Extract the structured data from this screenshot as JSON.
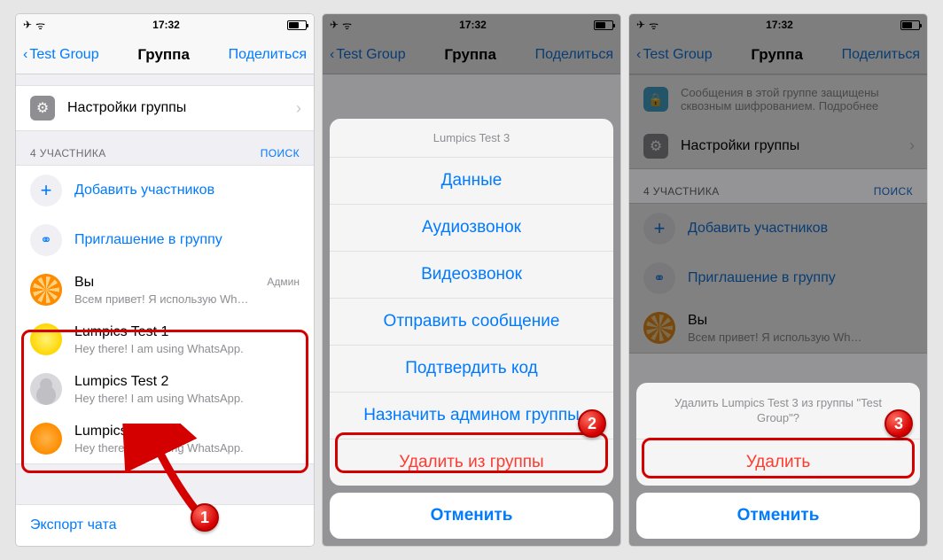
{
  "status": {
    "time": "17:32"
  },
  "nav": {
    "back": "Test Group",
    "title": "Группа",
    "action": "Поделиться"
  },
  "encryption_notice": "Сообщения в этой группе защищены сквозным шифрованием. Подробнее",
  "settings_row": "Настройки группы",
  "participants": {
    "header": "4 УЧАСТНИКА",
    "search": "ПОИСК",
    "add": "Добавить участников",
    "invite": "Приглашение в группу",
    "you": {
      "name": "Вы",
      "status": "Всем привет! Я использую Wh…",
      "role": "Админ"
    },
    "list": [
      {
        "name": "Lumpics Test 1",
        "status": "Hey there! I am using WhatsApp."
      },
      {
        "name": "Lumpics Test 2",
        "status": "Hey there! I am using WhatsApp."
      },
      {
        "name": "Lumpics Test 3",
        "status": "Hey there! I am using WhatsApp."
      }
    ]
  },
  "export": "Экспорт чата",
  "sheet1": {
    "title": "Lumpics Test 3",
    "options": [
      "Данные",
      "Аудиозвонок",
      "Видеозвонок",
      "Отправить сообщение",
      "Подтвердить код",
      "Назначить админом группы"
    ],
    "destructive": "Удалить из группы",
    "cancel": "Отменить"
  },
  "sheet2": {
    "prompt": "Удалить Lumpics Test 3 из группы \"Test Group\"?",
    "destructive": "Удалить",
    "cancel": "Отменить"
  },
  "ghost_row": "Lumpics Test 3",
  "badges": {
    "b1": "1",
    "b2": "2",
    "b3": "3"
  }
}
